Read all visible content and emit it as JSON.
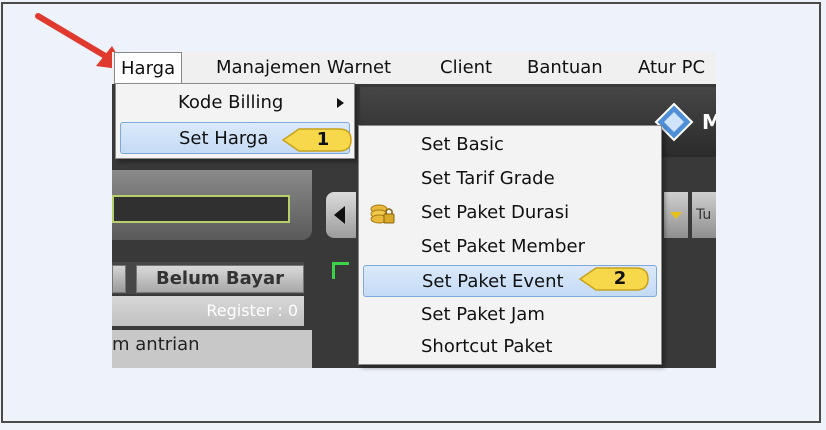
{
  "menubar": {
    "items": [
      {
        "label": "Harga"
      },
      {
        "label": "Manajemen Warnet"
      },
      {
        "label": "Client"
      },
      {
        "label": "Bantuan"
      },
      {
        "label": "Atur PC"
      }
    ]
  },
  "harga_menu": {
    "items": [
      {
        "label": "Kode Billing"
      },
      {
        "label": "Set Harga"
      }
    ]
  },
  "set_harga_submenu": {
    "items": [
      {
        "label": "Set Basic"
      },
      {
        "label": "Set Tarif Grade"
      },
      {
        "label": "Set Paket Durasi"
      },
      {
        "label": "Set Paket Member"
      },
      {
        "label": "Set Paket Event"
      },
      {
        "label": "Set Paket Jam"
      },
      {
        "label": "Shortcut Paket"
      }
    ]
  },
  "callouts": {
    "step1": "1",
    "step2": "2"
  },
  "background": {
    "tab_belum_bayar": "Belum Bayar",
    "register": "Register : 0",
    "antrian": "m antrian",
    "tu_button": "Tu",
    "right_m": "M"
  },
  "colors": {
    "arrow": "#e03a2f",
    "callout_fill": "#f7d84a",
    "highlight": "#c9ddf6"
  }
}
